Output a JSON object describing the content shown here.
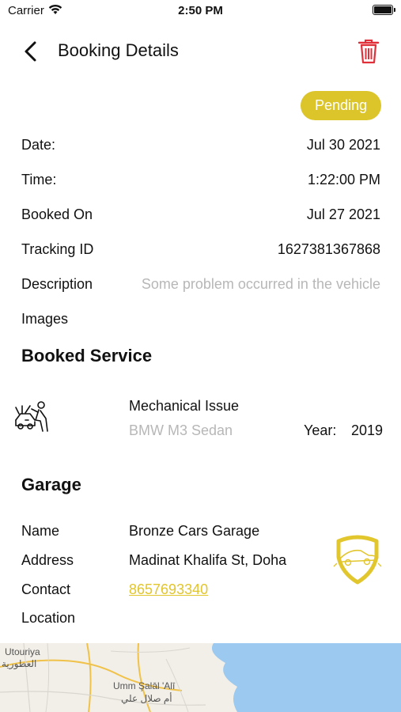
{
  "status_bar": {
    "carrier": "Carrier",
    "time": "2:50 PM"
  },
  "header": {
    "title": "Booking Details"
  },
  "status_badge": "Pending",
  "details": [
    {
      "label": "Date:",
      "value": "Jul 30 2021"
    },
    {
      "label": "Time:",
      "value": "1:22:00 PM"
    },
    {
      "label": "Booked On",
      "value": "Jul 27 2021"
    },
    {
      "label": "Tracking ID",
      "value": "1627381367868"
    },
    {
      "label": "Description",
      "value": "Some problem occurred in the vehicle"
    },
    {
      "label": "Images",
      "value": ""
    }
  ],
  "booked_service": {
    "heading": "Booked Service",
    "title": "Mechanical Issue",
    "vehicle": "BMW M3 Sedan",
    "year_label": "Year:",
    "year": "2019",
    "icon": "mechanic-icon"
  },
  "garage": {
    "heading": "Garage",
    "name_label": "Name",
    "name": "Bronze Cars Garage",
    "address_label": "Address",
    "address": "Madinat Khalifa St, Doha",
    "contact_label": "Contact",
    "contact": "8657693340",
    "location_label": "Location",
    "logo": "garage-shield-logo"
  },
  "map": {
    "labels": [
      {
        "text": "Utouriya"
      },
      {
        "text": "العطورية"
      },
      {
        "text": "Umm Şalāl 'Alī"
      },
      {
        "text": "أم صلال علي"
      }
    ]
  },
  "colors": {
    "accent": "#dcc52a",
    "delete": "#e0303a",
    "muted": "#b7b7b7",
    "water": "#9cc9f0"
  }
}
